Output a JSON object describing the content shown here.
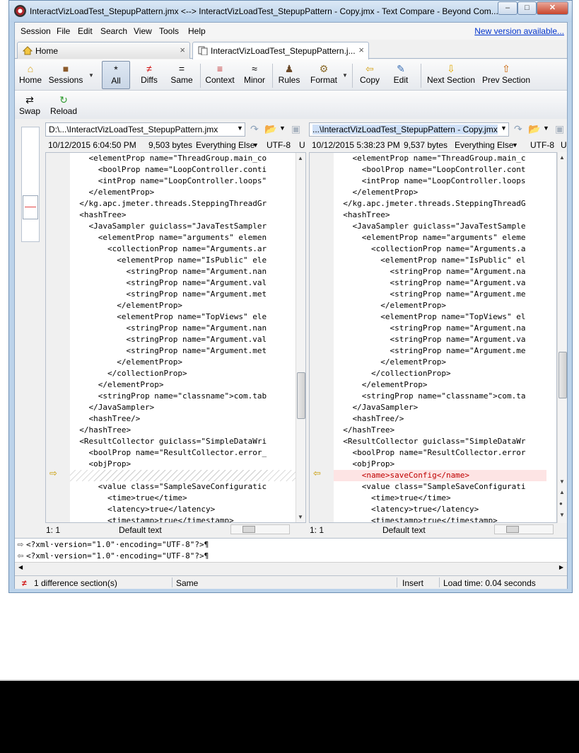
{
  "window": {
    "title": "InteractVizLoadTest_StepupPattern.jmx <--> InteractVizLoadTest_StepupPattern - Copy.jmx - Text Compare - Beyond Com...",
    "controls": {
      "minimize": "–",
      "maximize": "□",
      "close": "✕"
    }
  },
  "menu": {
    "items": [
      "Session",
      "File",
      "Edit",
      "Search",
      "View",
      "Tools",
      "Help"
    ],
    "new_version": "New version available..."
  },
  "tabs": [
    {
      "label": "Home",
      "icon": "home-icon",
      "close": "×"
    },
    {
      "label": "InteractVizLoadTest_StepupPattern.j...",
      "icon": "text-compare-icon",
      "close": "×"
    }
  ],
  "toolbar": {
    "home": "Home",
    "sessions": "Sessions",
    "all": "All",
    "diffs": "Diffs",
    "same": "Same",
    "context": "Context",
    "minor": "Minor",
    "rules": "Rules",
    "format": "Format",
    "copy": "Copy",
    "edit": "Edit",
    "next_section": "Next Section",
    "prev_section": "Prev Section",
    "swap": "Swap",
    "reload": "Reload"
  },
  "left": {
    "path": "D:\\...\\InteractVizLoadTest_StepupPattern.jmx",
    "date": "10/12/2015 6:04:50 PM",
    "size": "9,503 bytes",
    "filter": "Everything Else",
    "encoding": "UTF-8",
    "enc_extra": "U",
    "cursor": "1: 1",
    "text_mode": "Default text",
    "lines": [
      "    <elementProp name=\"ThreadGroup.main_co",
      "      <boolProp name=\"LoopController.conti",
      "      <intProp name=\"LoopController.loops\"",
      "    </elementProp>",
      "  </kg.apc.jmeter.threads.SteppingThreadGr",
      "  <hashTree>",
      "    <JavaSampler guiclass=\"JavaTestSampler",
      "      <elementProp name=\"arguments\" elemen",
      "        <collectionProp name=\"Arguments.ar",
      "          <elementProp name=\"IsPublic\" ele",
      "            <stringProp name=\"Argument.nan",
      "            <stringProp name=\"Argument.val",
      "            <stringProp name=\"Argument.met",
      "          </elementProp>",
      "          <elementProp name=\"TopViews\" ele",
      "            <stringProp name=\"Argument.nan",
      "            <stringProp name=\"Argument.val",
      "            <stringProp name=\"Argument.met",
      "          </elementProp>",
      "        </collectionProp>",
      "      </elementProp>",
      "      <stringProp name=\"classname\">com.tab",
      "    </JavaSampler>",
      "    <hashTree/>",
      "  </hashTree>",
      "  <ResultCollector guiclass=\"SimpleDataWri",
      "    <boolProp name=\"ResultCollector.error_",
      "    <objProp>",
      "",
      "      <value class=\"SampleSaveConfiguratic",
      "        <time>true</time>",
      "        <latency>true</latency>",
      "        <timestamp>true</timestamp>"
    ]
  },
  "right": {
    "path": "...\\InteractVizLoadTest_StepupPattern - Copy.jmx",
    "date": "10/12/2015 5:38:23 PM",
    "size": "9,537 bytes",
    "filter": "Everything Else",
    "encoding": "UTF-8",
    "enc_extra": "U",
    "cursor": "1: 1",
    "text_mode": "Default text",
    "lines": [
      "    <elementProp name=\"ThreadGroup.main_c",
      "      <boolProp name=\"LoopController.cont",
      "      <intProp name=\"LoopController.loops",
      "    </elementProp>",
      "  </kg.apc.jmeter.threads.SteppingThreadG",
      "  <hashTree>",
      "    <JavaSampler guiclass=\"JavaTestSample",
      "      <elementProp name=\"arguments\" eleme",
      "        <collectionProp name=\"Arguments.a",
      "          <elementProp name=\"IsPublic\" el",
      "            <stringProp name=\"Argument.na",
      "            <stringProp name=\"Argument.va",
      "            <stringProp name=\"Argument.me",
      "          </elementProp>",
      "          <elementProp name=\"TopViews\" el",
      "            <stringProp name=\"Argument.na",
      "            <stringProp name=\"Argument.va",
      "            <stringProp name=\"Argument.me",
      "          </elementProp>",
      "        </collectionProp>",
      "      </elementProp>",
      "      <stringProp name=\"classname\">com.ta",
      "    </JavaSampler>",
      "    <hashTree/>",
      "  </hashTree>",
      "  <ResultCollector guiclass=\"SimpleDataWr",
      "    <boolProp name=\"ResultCollector.error",
      "    <objProp>",
      "      <name>saveConfig</name>",
      "      <value class=\"SampleSaveConfigurati",
      "        <time>true</time>",
      "        <latency>true</latency>",
      "        <timestamp>true</timestamp>"
    ]
  },
  "detail": {
    "line1": "<?xml·version=\"1.0\"·encoding=\"UTF-8\"?>¶",
    "line2": "<?xml·version=\"1.0\"·encoding=\"UTF-8\"?>¶"
  },
  "status": {
    "diff_count": "1 difference section(s)",
    "same": "Same",
    "mode": "Insert",
    "load_time": "Load time: 0.04 seconds"
  },
  "colors": {
    "diff_text": "#c00000",
    "diff_bg": "#fde4e4",
    "accent": "#bcd3ea"
  }
}
